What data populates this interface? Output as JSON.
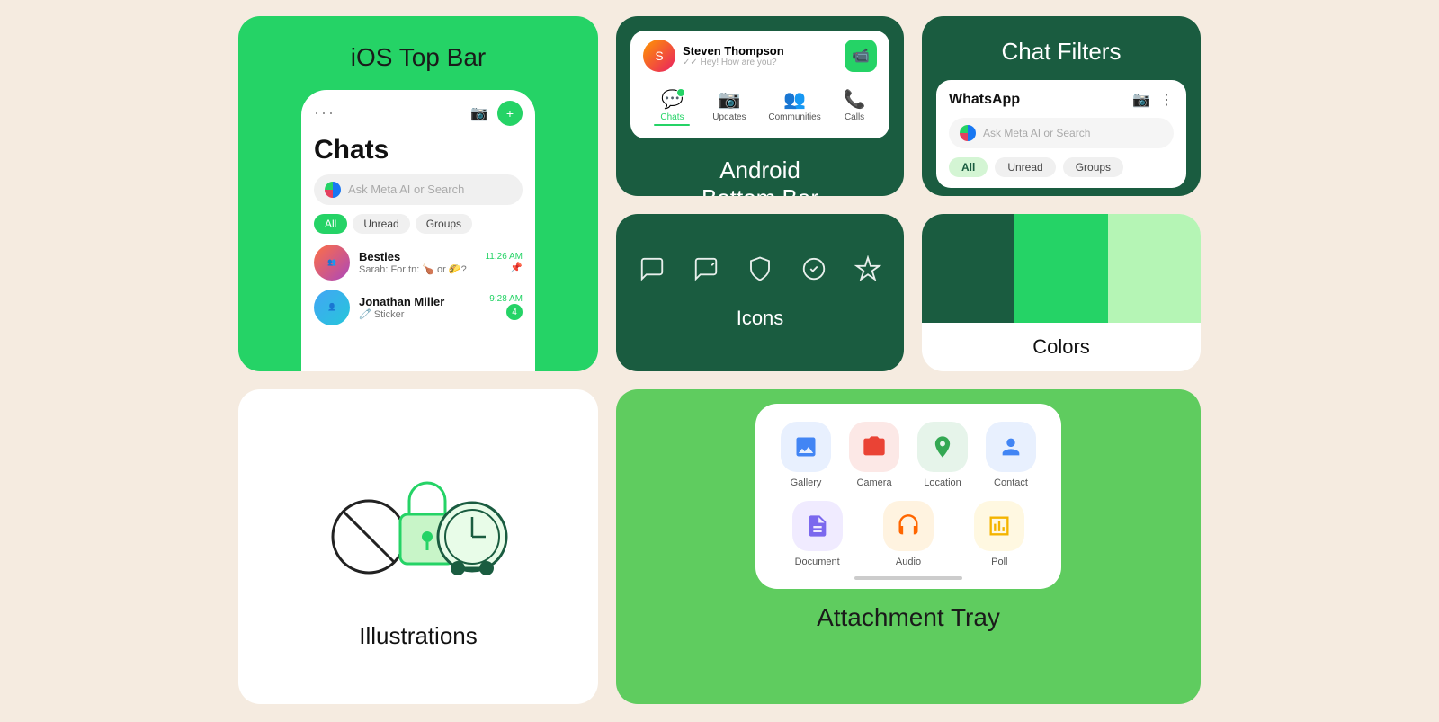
{
  "ios_card": {
    "title": "iOS Top Bar",
    "chats_label": "Chats",
    "search_placeholder": "Ask Meta AI or Search",
    "filters": [
      "All",
      "Unread",
      "Groups"
    ],
    "chat_items": [
      {
        "name": "Besties",
        "preview": "Sarah: For tn: 🍗 or 🌮?",
        "time": "11:26 AM",
        "pinned": true,
        "badge": null
      },
      {
        "name": "Jonathan Miller",
        "preview": "🧷 Sticker",
        "time": "9:28 AM",
        "pinned": false,
        "badge": "4"
      }
    ]
  },
  "android_card": {
    "label": "Android\nBottom Bar",
    "user_name": "Steven Thompson",
    "user_status": "✓✓ Hey! How are you?",
    "nav_items": [
      "Chats",
      "Updates",
      "Communities",
      "Calls"
    ]
  },
  "chat_filters_card": {
    "title": "Chat Filters",
    "app_name": "WhatsApp",
    "search_placeholder": "Ask Meta AI or Search",
    "filter_labels": [
      "WhatsApp",
      "Ask Meta AI or Search",
      "All",
      "Unread",
      "Groups"
    ]
  },
  "icons_card": {
    "label": "Icons",
    "icons": [
      "chat",
      "edit-chat",
      "shield",
      "check-badge",
      "sparkle"
    ]
  },
  "colors_card": {
    "label": "Colors",
    "swatches": [
      "#1a5c40",
      "#25d366",
      "#b5f5b5"
    ]
  },
  "illustrations_card": {
    "label": "Illustrations"
  },
  "attachment_card": {
    "title": "Attachment Tray",
    "items_row1": [
      {
        "label": "Gallery",
        "icon": "🖼️",
        "color": "#4285f4"
      },
      {
        "label": "Camera",
        "icon": "📷",
        "color": "#ea4335"
      },
      {
        "label": "Location",
        "icon": "📍",
        "color": "#34a853"
      },
      {
        "label": "Contact",
        "icon": "👤",
        "color": "#4285f4"
      }
    ],
    "items_row2": [
      {
        "label": "Document",
        "icon": "📄",
        "color": "#7b68ee"
      },
      {
        "label": "Audio",
        "icon": "🎧",
        "color": "#ff6600"
      },
      {
        "label": "Poll",
        "icon": "📊",
        "color": "#f4b400"
      }
    ]
  }
}
